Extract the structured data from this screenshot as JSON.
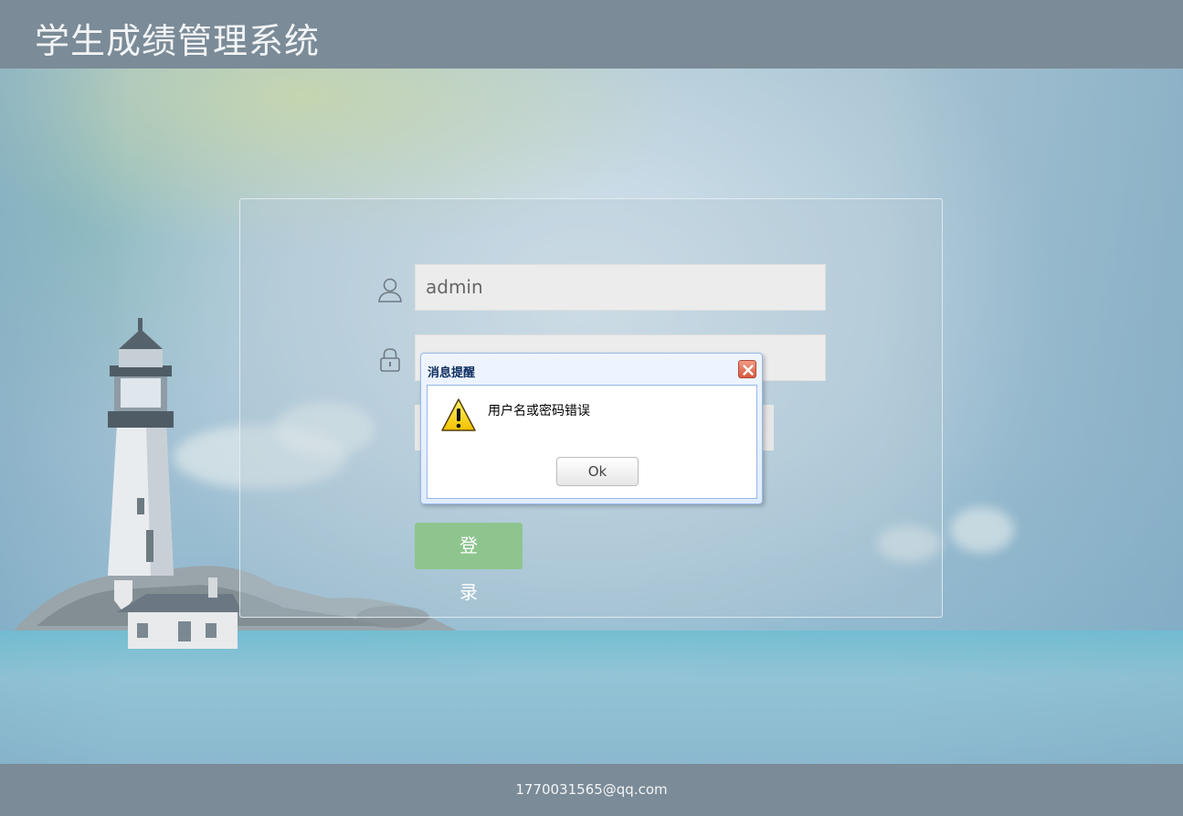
{
  "header": {
    "title": "学生成绩管理系统"
  },
  "login": {
    "username_value": "admin",
    "password_value": "",
    "submit_label": "登 录"
  },
  "dialog": {
    "title": "消息提醒",
    "message": "用户名或密码错误",
    "ok_label": "Ok"
  },
  "footer": {
    "contact": "1770031565@qq.com"
  },
  "icons": {
    "username": "user-icon",
    "password": "lock-icon",
    "warning": "warning-icon",
    "close": "close-icon"
  },
  "colors": {
    "bar": "#7b8b97",
    "login_button": "#8ec58e",
    "dialog_border": "#95b8e7"
  }
}
